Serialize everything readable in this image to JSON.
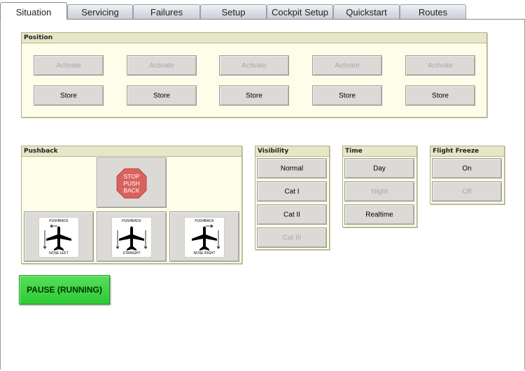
{
  "tabs": [
    {
      "label": "Situation"
    },
    {
      "label": "Servicing"
    },
    {
      "label": "Failures"
    },
    {
      "label": "Setup"
    },
    {
      "label": "Cockpit Setup"
    },
    {
      "label": "Quickstart"
    },
    {
      "label": "Routes"
    }
  ],
  "position": {
    "title": "Position",
    "activate_label": "Activate",
    "store_label": "Store"
  },
  "pushback": {
    "title": "Pushback",
    "stop_text": [
      "STOP",
      "PUSH",
      "BACK"
    ],
    "options": [
      {
        "top": "PUSHBACK",
        "bottom": "NOSE LEFT"
      },
      {
        "top": "PUSHBACK",
        "bottom": "STRAIGHT"
      },
      {
        "top": "PUSHBACK",
        "bottom": "NOSE RIGHT"
      }
    ]
  },
  "visibility": {
    "title": "Visibility",
    "options": [
      "Normal",
      "Cat I",
      "Cat II",
      "Cat III"
    ]
  },
  "time": {
    "title": "Time",
    "options": [
      "Day",
      "Night",
      "Realtime"
    ]
  },
  "flight_freeze": {
    "title": "Flight Freeze",
    "options": [
      "On",
      "Off"
    ]
  },
  "pause": {
    "label": "PAUSE (RUNNING)"
  },
  "colors": {
    "stop_sign": "#d9625f",
    "pause_green": "#3fd445"
  }
}
